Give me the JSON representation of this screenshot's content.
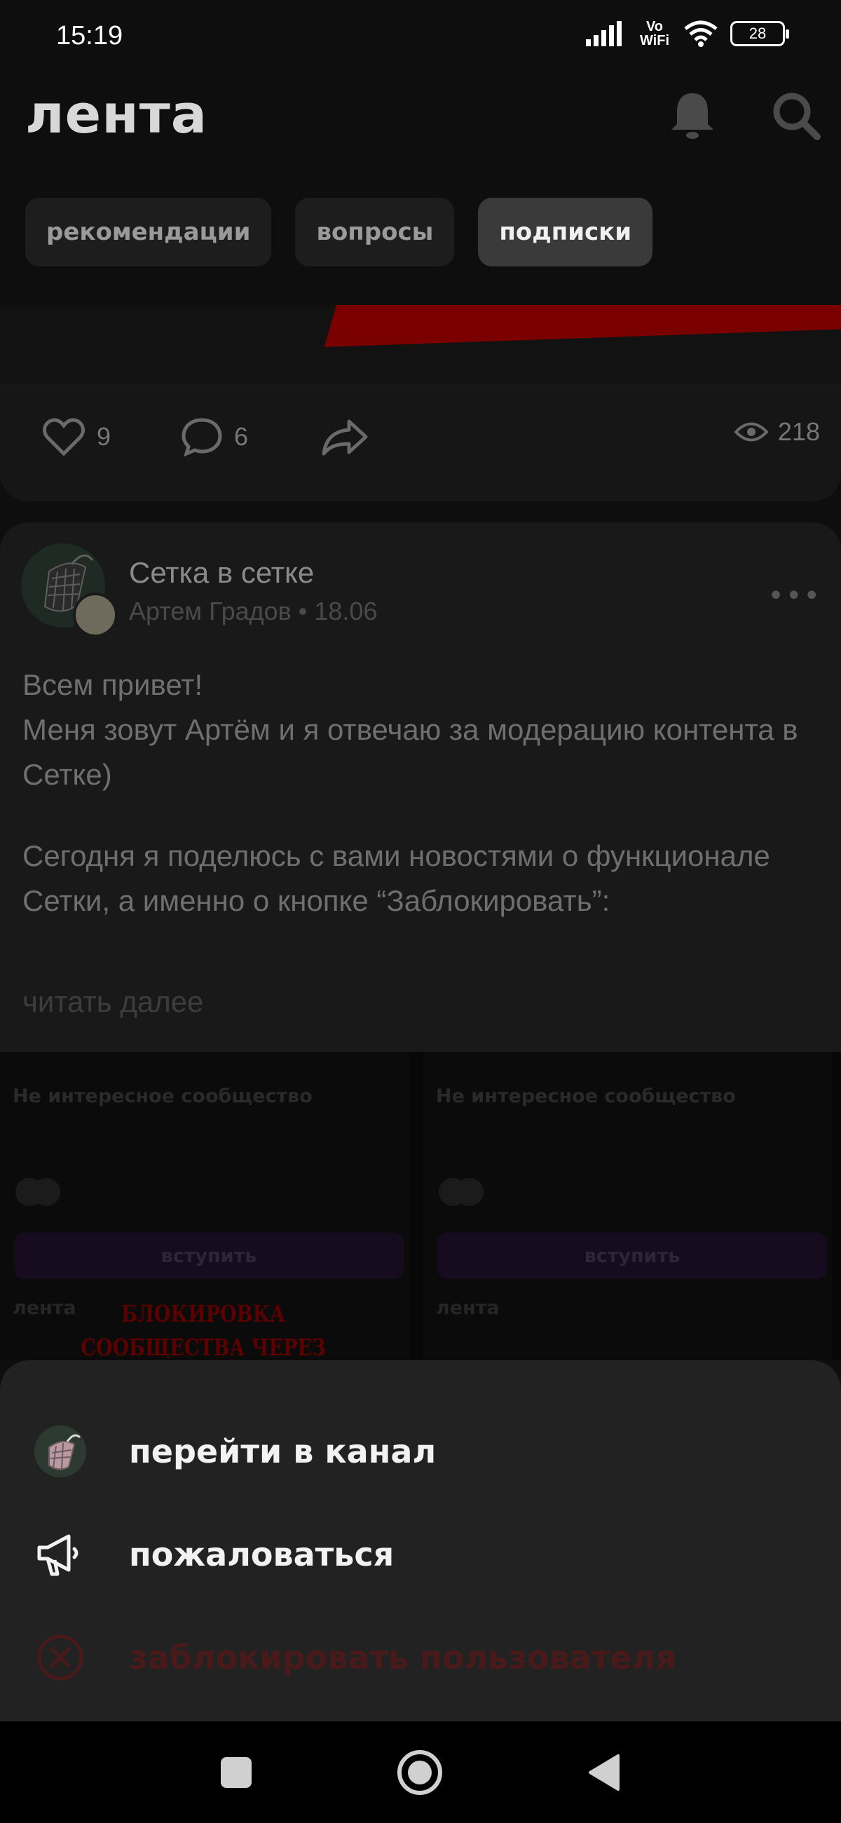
{
  "status_bar": {
    "time": "15:19",
    "network": "Vo WiFi",
    "battery": "28"
  },
  "header": {
    "title": "лента",
    "icons": [
      "bell-icon",
      "search-icon"
    ]
  },
  "tabs": [
    {
      "label": "рекомендации",
      "active": false
    },
    {
      "label": "вопросы",
      "active": false
    },
    {
      "label": "подписки",
      "active": true
    }
  ],
  "post_previous": {
    "likes": "9",
    "comments": "6",
    "views": "218"
  },
  "post": {
    "channel": "Сетка в сетке",
    "author_date": "Артем Градов • 18.06",
    "menu": "•••",
    "paragraphs": [
      "Всем привет!\nМеня зовут Артём и я отвечаю за модерацию контента в Сетке)",
      "Сегодня я поделюсь с вами новостями о функционале Сетки, а именно о кнопке “Заблокировать”:"
    ],
    "read_more": "читать далее"
  },
  "preview_cards": [
    {
      "title": "Не интересное сообщество",
      "join_label": "вступить",
      "feed_label": "лента"
    },
    {
      "title": "Не интересное сообщество",
      "join_label": "вступить",
      "feed_label": "лента"
    }
  ],
  "image_caption": "БЛОКИРОВКА СООБЩЕСТВА ЧЕРЕЗ ПОСТ",
  "sheet": {
    "items": [
      {
        "label": "перейти в канал",
        "icon": "channel-avatar-icon"
      },
      {
        "label": "пожаловаться",
        "icon": "megaphone-icon"
      },
      {
        "label": "заблокировать пользователя",
        "icon": "block-icon",
        "color": "#4a1a1a"
      }
    ]
  },
  "navbar": {
    "buttons": [
      "recents-square-icon",
      "home-circle-icon",
      "back-triangle-icon"
    ]
  },
  "colors": {
    "background": "#0e0e0e",
    "sheet": "#222222",
    "tab_active": "#3a3a3a",
    "danger": "#4a1a1a"
  }
}
